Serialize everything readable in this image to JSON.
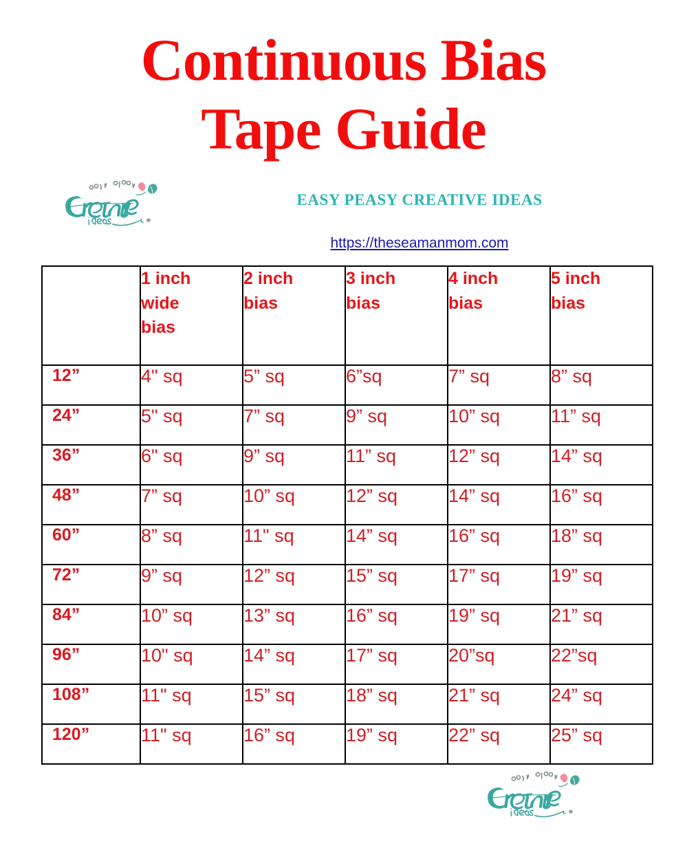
{
  "document": {
    "title_line1": "Continuous Bias",
    "title_line2": "Tape Guide",
    "title_color": "#f20d0d"
  },
  "brand": {
    "logo_word_top": "easy peasy",
    "logo_word_main": "Creative",
    "logo_word_bottom": "ideas",
    "tagline": "EASY PEASY CREATIVE IDEAS",
    "tagline_color": "#2cb5b5",
    "url": "https://theseamanmom.com",
    "url_color": "#1a1aae"
  },
  "table": {
    "corner_header": "",
    "headers": [
      "1 inch wide bias",
      "2 inch bias",
      "3 inch bias",
      "4 inch bias",
      "5 inch bias"
    ],
    "header_color": "#e81519",
    "body_color": "#cf2026",
    "rows": [
      {
        "label": "12”",
        "cells": [
          "4\" sq",
          "5” sq",
          "6”sq",
          "7” sq",
          "8” sq"
        ]
      },
      {
        "label": "24”",
        "cells": [
          "5\" sq",
          "7” sq",
          "9” sq",
          "10” sq",
          "11” sq"
        ]
      },
      {
        "label": "36”",
        "cells": [
          "6\" sq",
          "9” sq",
          "11” sq",
          "12” sq",
          "14” sq"
        ]
      },
      {
        "label": "48”",
        "cells": [
          "7” sq",
          "10” sq",
          "12” sq",
          "14” sq",
          "16” sq"
        ]
      },
      {
        "label": "60”",
        "cells": [
          "8” sq",
          "11\" sq",
          "14” sq",
          "16” sq",
          "18” sq"
        ]
      },
      {
        "label": "72”",
        "cells": [
          "9” sq",
          "12” sq",
          "15” sq",
          "17” sq",
          "19” sq"
        ]
      },
      {
        "label": "84”",
        "cells": [
          "10” sq",
          "13” sq",
          "16” sq",
          "19” sq",
          "21” sq"
        ]
      },
      {
        "label": "96”",
        "cells": [
          "10\" sq",
          "14” sq",
          "17” sq",
          "20”sq",
          "22”sq"
        ]
      },
      {
        "label": "108”",
        "cells": [
          "11\" sq",
          "15” sq",
          "18” sq",
          "21” sq",
          "24” sq"
        ]
      },
      {
        "label": "120”",
        "cells": [
          "11\" sq",
          "16” sq",
          "19” sq",
          "22” sq",
          "25” sq"
        ]
      }
    ]
  }
}
